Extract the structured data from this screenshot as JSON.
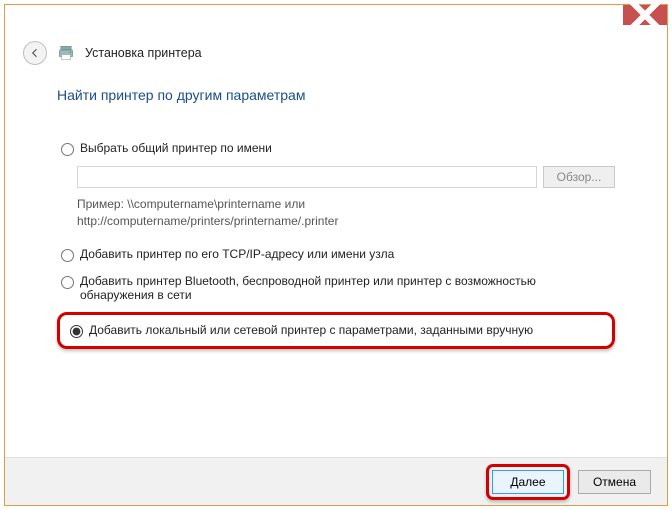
{
  "window": {
    "title": "Установка принтера"
  },
  "heading": "Найти принтер по другим параметрам",
  "options": {
    "byName": {
      "label": "Выбрать общий принтер по имени",
      "browse": "Обзор...",
      "example": "Пример: \\\\computername\\printername или\nhttp://computername/printers/printername/.printer"
    },
    "byTcpIp": {
      "label": "Добавить принтер по его TCP/IP-адресу или имени узла"
    },
    "bluetooth": {
      "label": "Добавить принтер Bluetooth, беспроводной принтер или принтер с возможностью обнаружения в сети"
    },
    "manual": {
      "label": "Добавить локальный или сетевой принтер с параметрами, заданными вручную"
    }
  },
  "buttons": {
    "next": "Далее",
    "cancel": "Отмена"
  }
}
